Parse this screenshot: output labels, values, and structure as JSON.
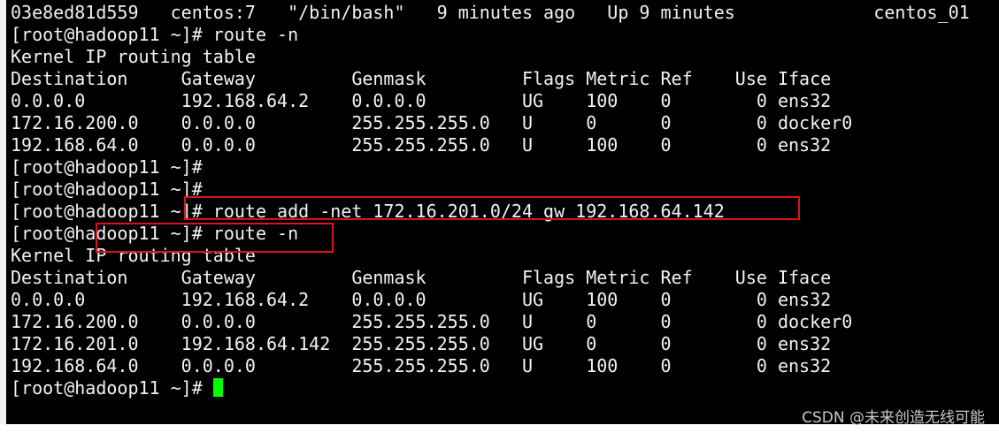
{
  "terminal": {
    "lines": [
      "03e8ed81d559   centos:7   \"/bin/bash\"   9 minutes ago   Up 9 minutes             centos_01",
      "[root@hadoop11 ~]# route -n",
      "Kernel IP routing table",
      "Destination     Gateway         Genmask         Flags Metric Ref    Use Iface",
      "0.0.0.0         192.168.64.2    0.0.0.0         UG    100    0        0 ens32",
      "172.16.200.0    0.0.0.0         255.255.255.0   U     0      0        0 docker0",
      "192.168.64.0    0.0.0.0         255.255.255.0   U     100    0        0 ens32",
      "[root@hadoop11 ~]#",
      "[root@hadoop11 ~]#",
      "[root@hadoop11 ~]# route add -net 172.16.201.0/24 gw 192.168.64.142",
      "[root@hadoop11 ~]# route -n",
      "Kernel IP routing table",
      "Destination     Gateway         Genmask         Flags Metric Ref    Use Iface",
      "0.0.0.0         192.168.64.2    0.0.0.0         UG    100    0        0 ens32",
      "172.16.200.0    0.0.0.0         255.255.255.0   U     0      0        0 docker0",
      "172.16.201.0    192.168.64.142  255.255.255.0   UG    0      0        0 ens32",
      "192.168.64.0    0.0.0.0         255.255.255.0   U     100    0        0 ens32",
      "[root@hadoop11 ~]# "
    ]
  },
  "watermark": "CSDN @未来创造无线可能",
  "colors": {
    "background": "#000000",
    "text": "#f2f2f2",
    "cursor": "#00ff00",
    "highlight": "#d9141d"
  }
}
